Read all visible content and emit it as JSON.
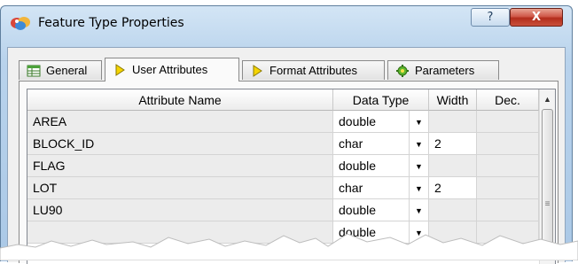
{
  "window": {
    "title": "Feature Type Properties",
    "help_label": "?",
    "close_label": "X"
  },
  "tabs": [
    {
      "label": "General",
      "icon": "table-icon"
    },
    {
      "label": "User Attributes",
      "icon": "diamond-icon"
    },
    {
      "label": "Format Attributes",
      "icon": "diamond-icon"
    },
    {
      "label": "Parameters",
      "icon": "gear-icon"
    }
  ],
  "grid": {
    "headers": {
      "name": "Attribute Name",
      "type": "Data Type",
      "width": "Width",
      "dec": "Dec."
    },
    "rows": [
      {
        "name": "AREA",
        "type": "double",
        "width": "",
        "dec": ""
      },
      {
        "name": "BLOCK_ID",
        "type": "char",
        "width": "2",
        "dec": ""
      },
      {
        "name": "FLAG",
        "type": "double",
        "width": "",
        "dec": ""
      },
      {
        "name": "LOT",
        "type": "char",
        "width": "2",
        "dec": ""
      },
      {
        "name": "LU90",
        "type": "double",
        "width": "",
        "dec": ""
      },
      {
        "name": "",
        "type": "double",
        "width": "",
        "dec": ""
      }
    ]
  },
  "colors": {
    "title_bar": "#b9d3ec",
    "close_button": "#c9503b",
    "grid_border": "#828790"
  }
}
